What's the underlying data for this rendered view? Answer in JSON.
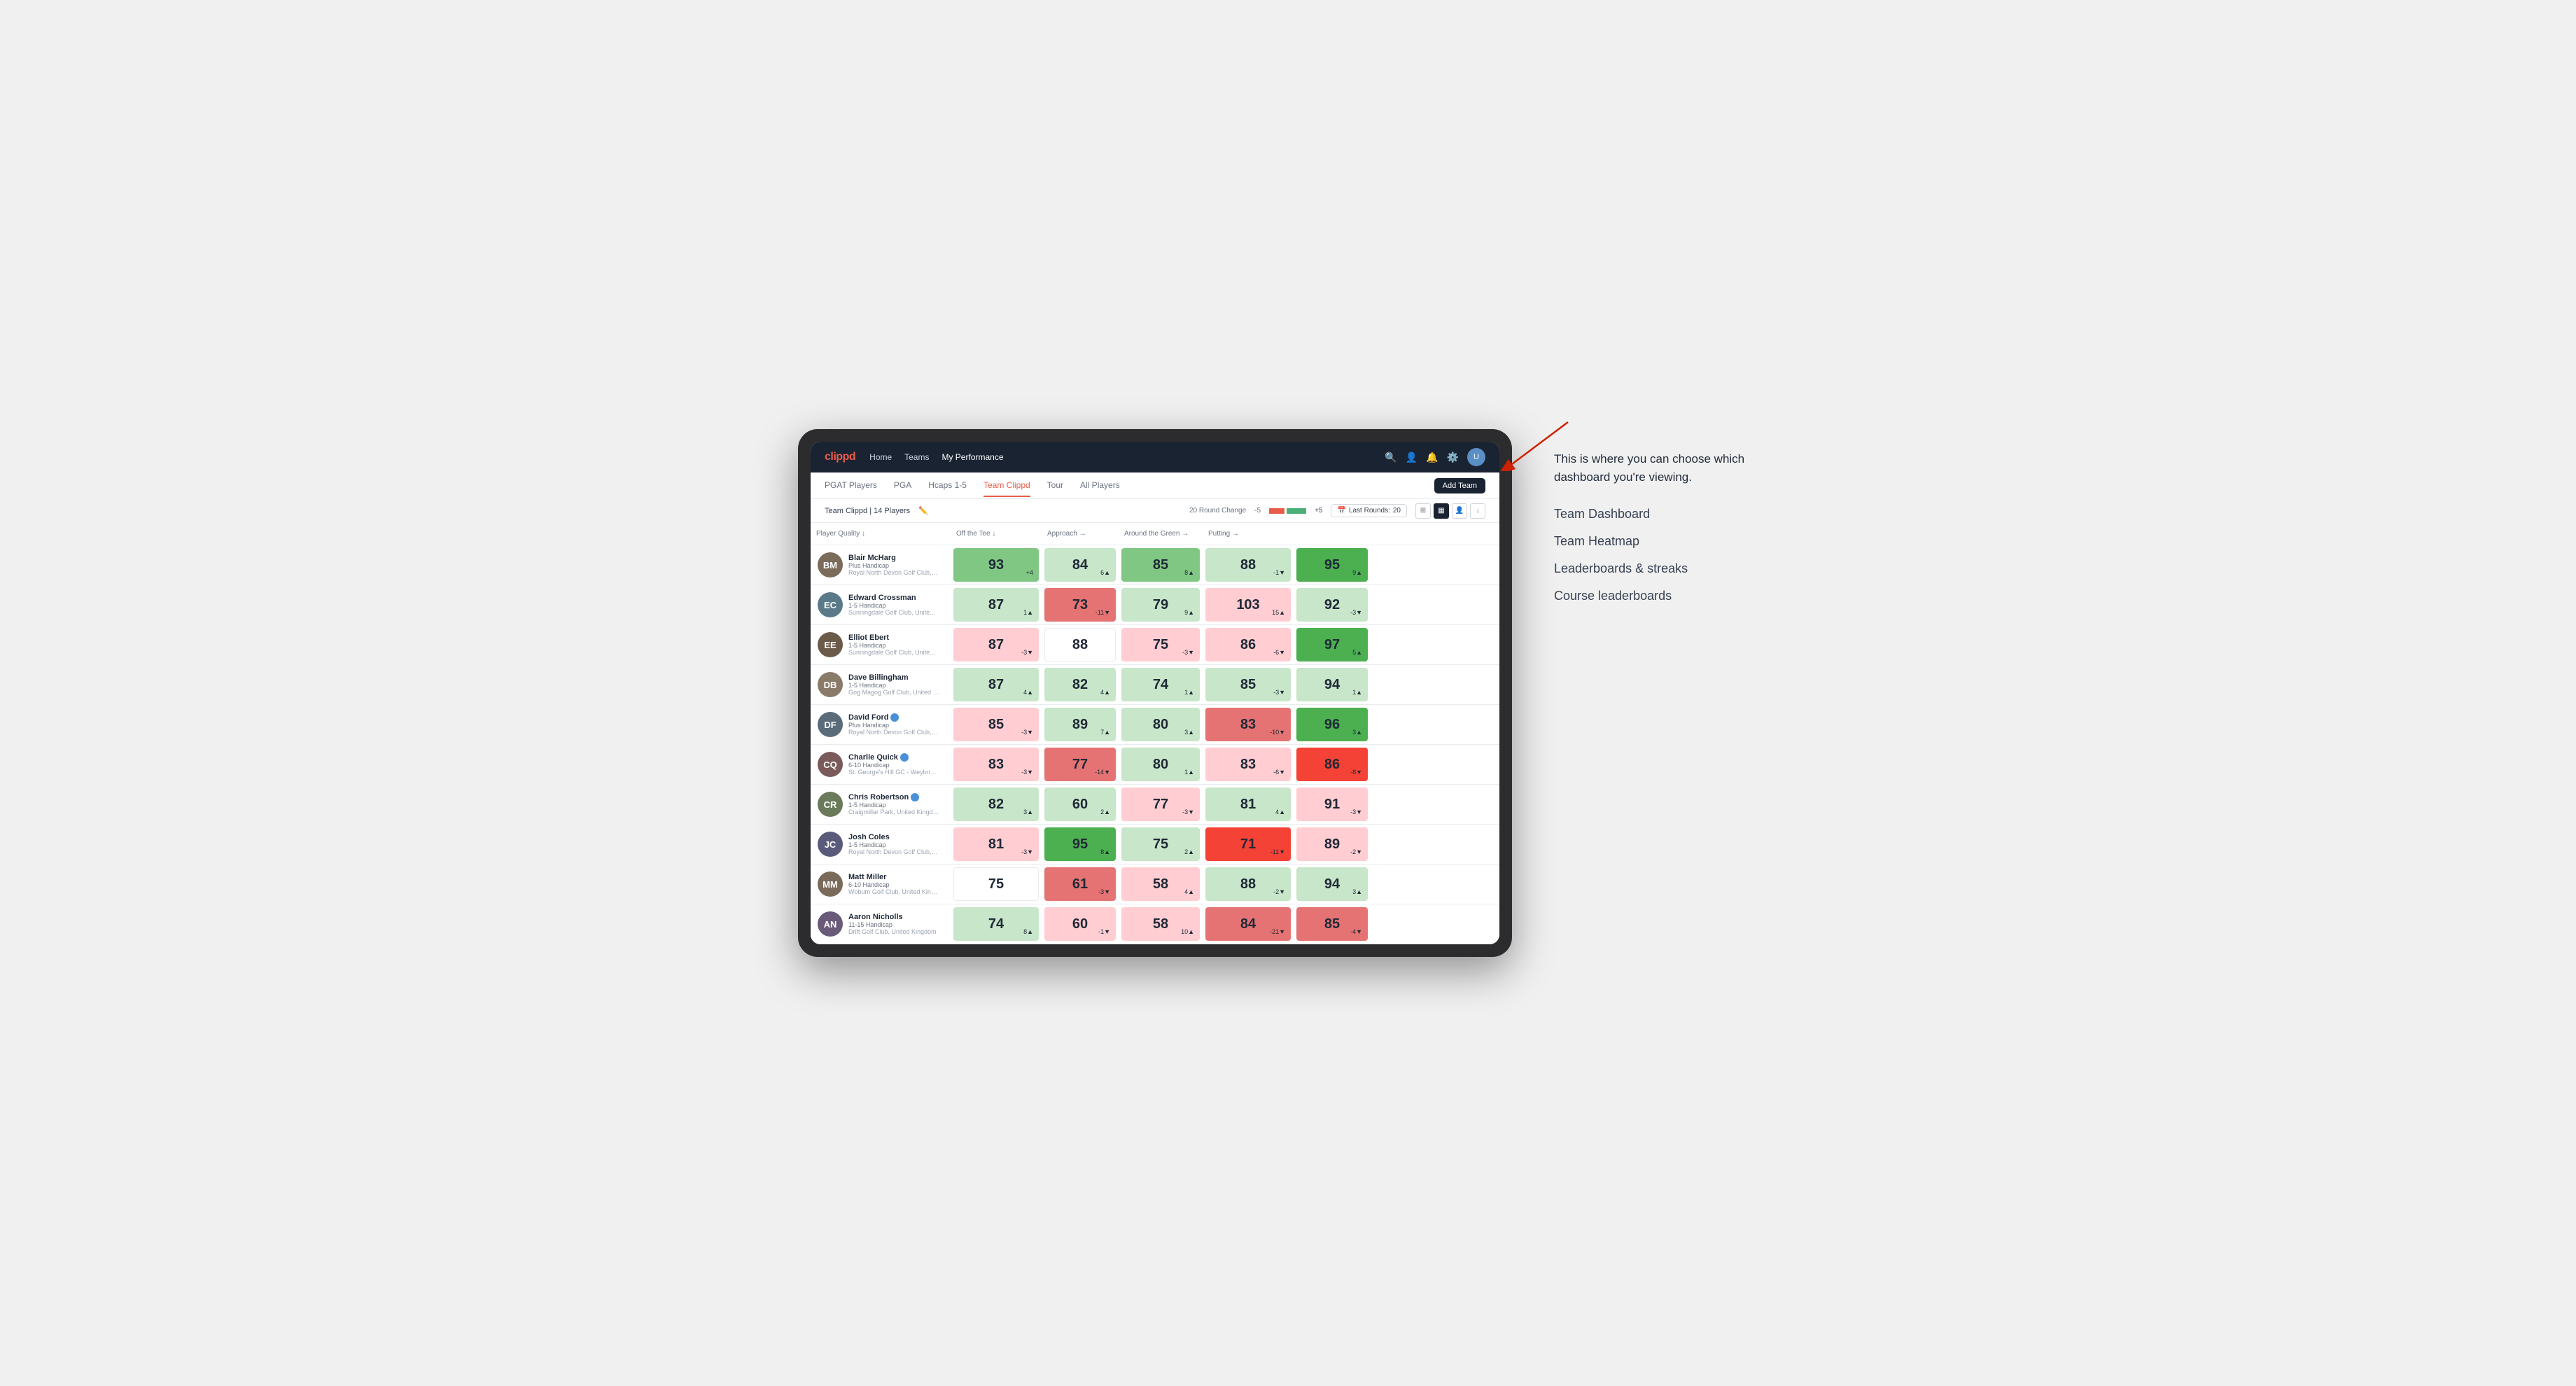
{
  "annotation": {
    "description": "This is where you can choose which dashboard you're viewing.",
    "items": [
      {
        "label": "Team Dashboard"
      },
      {
        "label": "Team Heatmap"
      },
      {
        "label": "Leaderboards & streaks"
      },
      {
        "label": "Course leaderboards"
      }
    ]
  },
  "nav": {
    "logo": "clippd",
    "links": [
      "Home",
      "Teams",
      "My Performance"
    ],
    "active_link": "My Performance"
  },
  "tabs": {
    "items": [
      "PGAT Players",
      "PGA",
      "Hcaps 1-5",
      "Team Clippd",
      "Tour",
      "All Players"
    ],
    "active": "Team Clippd"
  },
  "subheader": {
    "team_label": "Team Clippd",
    "player_count": "14 Players",
    "round_change_label": "20 Round Change",
    "change_minus": "-5",
    "change_plus": "+5",
    "last_rounds_label": "Last Rounds:",
    "last_rounds_value": "20",
    "add_team": "Add Team"
  },
  "table": {
    "columns": [
      "Player Quality ↓",
      "Off the Tee ↓",
      "Approach →",
      "Around the Green →",
      "Putting →"
    ],
    "players": [
      {
        "name": "Blair McHarg",
        "handicap": "Plus Handicap",
        "club": "Royal North Devon Golf Club, United Kingdom",
        "avatar_initials": "BM",
        "avatar_color": "#7a6b5a",
        "scores": [
          {
            "value": 93,
            "change": "+4",
            "direction": "up",
            "bg": "bg-green-med"
          },
          {
            "value": 84,
            "change": "6▲",
            "direction": "up",
            "bg": "bg-green-light"
          },
          {
            "value": 85,
            "change": "8▲",
            "direction": "up",
            "bg": "bg-green-med"
          },
          {
            "value": 88,
            "change": "-1▼",
            "direction": "down",
            "bg": "bg-green-light"
          },
          {
            "value": 95,
            "change": "9▲",
            "direction": "up",
            "bg": "bg-green-dark"
          }
        ]
      },
      {
        "name": "Edward Crossman",
        "handicap": "1-5 Handicap",
        "club": "Sunningdale Golf Club, United Kingdom",
        "avatar_initials": "EC",
        "avatar_color": "#5a7a8a",
        "scores": [
          {
            "value": 87,
            "change": "1▲",
            "direction": "up",
            "bg": "bg-green-light"
          },
          {
            "value": 73,
            "change": "-11▼",
            "direction": "down",
            "bg": "bg-red-med"
          },
          {
            "value": 79,
            "change": "9▲",
            "direction": "up",
            "bg": "bg-green-light"
          },
          {
            "value": 103,
            "change": "15▲",
            "direction": "up",
            "bg": "bg-red-light"
          },
          {
            "value": 92,
            "change": "-3▼",
            "direction": "down",
            "bg": "bg-green-light"
          }
        ]
      },
      {
        "name": "Elliot Ebert",
        "handicap": "1-5 Handicap",
        "club": "Sunningdale Golf Club, United Kingdom",
        "avatar_initials": "EE",
        "avatar_color": "#6b5a4a",
        "scores": [
          {
            "value": 87,
            "change": "-3▼",
            "direction": "down",
            "bg": "bg-red-light"
          },
          {
            "value": 88,
            "change": "",
            "direction": "none",
            "bg": "bg-white"
          },
          {
            "value": 75,
            "change": "-3▼",
            "direction": "down",
            "bg": "bg-red-light"
          },
          {
            "value": 86,
            "change": "-6▼",
            "direction": "down",
            "bg": "bg-red-light"
          },
          {
            "value": 97,
            "change": "5▲",
            "direction": "up",
            "bg": "bg-green-dark"
          }
        ]
      },
      {
        "name": "Dave Billingham",
        "handicap": "1-5 Handicap",
        "club": "Gog Magog Golf Club, United Kingdom",
        "avatar_initials": "DB",
        "avatar_color": "#8a7a6a",
        "scores": [
          {
            "value": 87,
            "change": "4▲",
            "direction": "up",
            "bg": "bg-green-light"
          },
          {
            "value": 82,
            "change": "4▲",
            "direction": "up",
            "bg": "bg-green-light"
          },
          {
            "value": 74,
            "change": "1▲",
            "direction": "up",
            "bg": "bg-green-light"
          },
          {
            "value": 85,
            "change": "-3▼",
            "direction": "down",
            "bg": "bg-green-light"
          },
          {
            "value": 94,
            "change": "1▲",
            "direction": "up",
            "bg": "bg-green-light"
          }
        ]
      },
      {
        "name": "David Ford",
        "handicap": "Plus Handicap",
        "club": "Royal North Devon Golf Club, United Kingdom",
        "avatar_initials": "DF",
        "avatar_color": "#5a6b7a",
        "verified": true,
        "scores": [
          {
            "value": 85,
            "change": "-3▼",
            "direction": "down",
            "bg": "bg-red-light"
          },
          {
            "value": 89,
            "change": "7▲",
            "direction": "up",
            "bg": "bg-green-light"
          },
          {
            "value": 80,
            "change": "3▲",
            "direction": "up",
            "bg": "bg-green-light"
          },
          {
            "value": 83,
            "change": "-10▼",
            "direction": "down",
            "bg": "bg-red-med"
          },
          {
            "value": 96,
            "change": "3▲",
            "direction": "up",
            "bg": "bg-green-dark"
          }
        ]
      },
      {
        "name": "Charlie Quick",
        "handicap": "6-10 Handicap",
        "club": "St. George's Hill GC - Weybridge - Surrey, Uni...",
        "avatar_initials": "CQ",
        "avatar_color": "#7a5a5a",
        "verified": true,
        "scores": [
          {
            "value": 83,
            "change": "-3▼",
            "direction": "down",
            "bg": "bg-red-light"
          },
          {
            "value": 77,
            "change": "-14▼",
            "direction": "down",
            "bg": "bg-red-med"
          },
          {
            "value": 80,
            "change": "1▲",
            "direction": "up",
            "bg": "bg-green-light"
          },
          {
            "value": 83,
            "change": "-6▼",
            "direction": "down",
            "bg": "bg-red-light"
          },
          {
            "value": 86,
            "change": "-8▼",
            "direction": "down",
            "bg": "bg-red-dark"
          }
        ]
      },
      {
        "name": "Chris Robertson",
        "handicap": "1-5 Handicap",
        "club": "Craigmillar Park, United Kingdom",
        "avatar_initials": "CR",
        "avatar_color": "#6a7a5a",
        "verified": true,
        "scores": [
          {
            "value": 82,
            "change": "3▲",
            "direction": "up",
            "bg": "bg-green-light"
          },
          {
            "value": 60,
            "change": "2▲",
            "direction": "up",
            "bg": "bg-green-light"
          },
          {
            "value": 77,
            "change": "-3▼",
            "direction": "down",
            "bg": "bg-red-light"
          },
          {
            "value": 81,
            "change": "4▲",
            "direction": "up",
            "bg": "bg-green-light"
          },
          {
            "value": 91,
            "change": "-3▼",
            "direction": "down",
            "bg": "bg-red-light"
          }
        ]
      },
      {
        "name": "Josh Coles",
        "handicap": "1-5 Handicap",
        "club": "Royal North Devon Golf Club, United Kingdom",
        "avatar_initials": "JC",
        "avatar_color": "#5a5a7a",
        "scores": [
          {
            "value": 81,
            "change": "-3▼",
            "direction": "down",
            "bg": "bg-red-light"
          },
          {
            "value": 95,
            "change": "8▲",
            "direction": "up",
            "bg": "bg-green-dark"
          },
          {
            "value": 75,
            "change": "2▲",
            "direction": "up",
            "bg": "bg-green-light"
          },
          {
            "value": 71,
            "change": "-11▼",
            "direction": "down",
            "bg": "bg-red-dark"
          },
          {
            "value": 89,
            "change": "-2▼",
            "direction": "down",
            "bg": "bg-red-light"
          }
        ]
      },
      {
        "name": "Matt Miller",
        "handicap": "6-10 Handicap",
        "club": "Woburn Golf Club, United Kingdom",
        "avatar_initials": "MM",
        "avatar_color": "#7a6a5a",
        "scores": [
          {
            "value": 75,
            "change": "",
            "direction": "none",
            "bg": "bg-white"
          },
          {
            "value": 61,
            "change": "-3▼",
            "direction": "down",
            "bg": "bg-red-med"
          },
          {
            "value": 58,
            "change": "4▲",
            "direction": "up",
            "bg": "bg-red-light"
          },
          {
            "value": 88,
            "change": "-2▼",
            "direction": "down",
            "bg": "bg-green-light"
          },
          {
            "value": 94,
            "change": "3▲",
            "direction": "up",
            "bg": "bg-green-light"
          }
        ]
      },
      {
        "name": "Aaron Nicholls",
        "handicap": "11-15 Handicap",
        "club": "Drift Golf Club, United Kingdom",
        "avatar_initials": "AN",
        "avatar_color": "#6a5a7a",
        "scores": [
          {
            "value": 74,
            "change": "8▲",
            "direction": "up",
            "bg": "bg-green-light"
          },
          {
            "value": 60,
            "change": "-1▼",
            "direction": "down",
            "bg": "bg-red-light"
          },
          {
            "value": 58,
            "change": "10▲",
            "direction": "up",
            "bg": "bg-red-light"
          },
          {
            "value": 84,
            "change": "-21▼",
            "direction": "down",
            "bg": "bg-red-med"
          },
          {
            "value": 85,
            "change": "-4▼",
            "direction": "down",
            "bg": "bg-red-med"
          }
        ]
      }
    ]
  }
}
